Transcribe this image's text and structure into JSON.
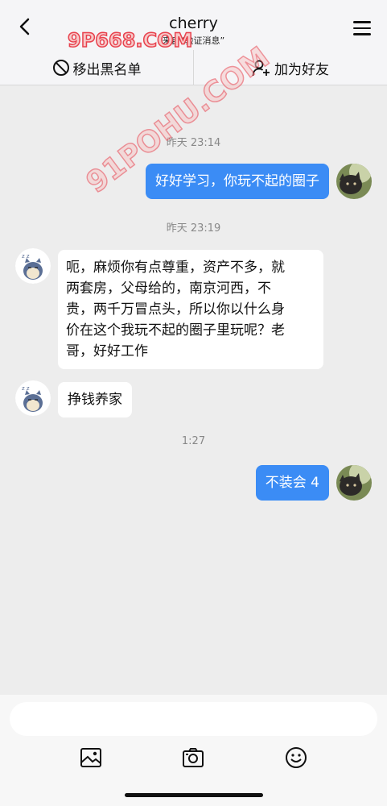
{
  "header": {
    "title": "cherry",
    "subtitle": "来自“验证消息”"
  },
  "actions": {
    "remove_blacklist": "移出黑名单",
    "add_friend": "加为好友"
  },
  "messages": [
    {
      "type": "time",
      "text": "昨天 23:14"
    },
    {
      "type": "me",
      "text": "好好学习，你玩不起的圈子"
    },
    {
      "type": "time",
      "text": "昨天 23:19"
    },
    {
      "type": "them",
      "lines": [
        "呃，麻烦你有点尊重，资产不多，就",
        "两套房，父母给的，南京河西，不",
        "贵，两千万冒点头，所以你以什么身",
        "价在这个我玩不起的圈子里玩呢？老",
        "哥，好好工作"
      ]
    },
    {
      "type": "them",
      "text": "挣钱养家"
    },
    {
      "type": "time",
      "text": "1:27"
    },
    {
      "type": "me",
      "text": "不装会 4"
    }
  ],
  "watermarks": [
    "9P668.COM",
    "91POHU.COM"
  ],
  "input": {
    "placeholder": ""
  },
  "toolbar": {
    "icons": [
      "image-icon",
      "camera-icon",
      "emoji-icon"
    ]
  },
  "colors": {
    "my_bubble": "#3b8cf5",
    "their_bubble": "#ffffff",
    "background": "#ededed"
  }
}
